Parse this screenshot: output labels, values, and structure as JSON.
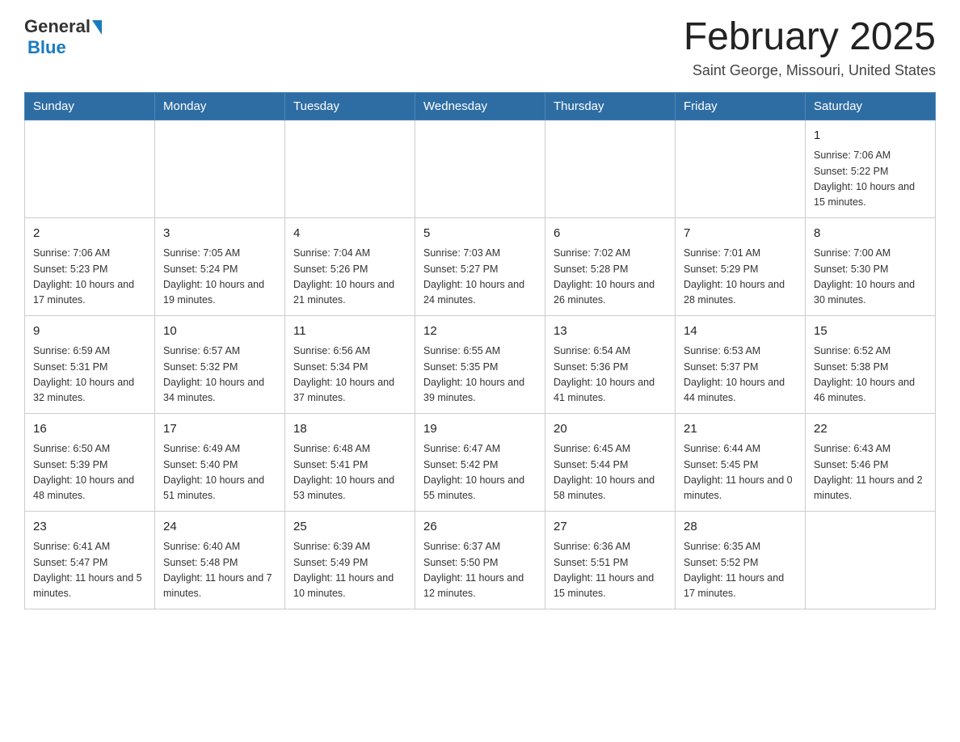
{
  "header": {
    "logo_general": "General",
    "logo_blue": "Blue",
    "month_title": "February 2025",
    "location": "Saint George, Missouri, United States"
  },
  "weekdays": [
    "Sunday",
    "Monday",
    "Tuesday",
    "Wednesday",
    "Thursday",
    "Friday",
    "Saturday"
  ],
  "weeks": [
    [
      {
        "day": "",
        "info": ""
      },
      {
        "day": "",
        "info": ""
      },
      {
        "day": "",
        "info": ""
      },
      {
        "day": "",
        "info": ""
      },
      {
        "day": "",
        "info": ""
      },
      {
        "day": "",
        "info": ""
      },
      {
        "day": "1",
        "info": "Sunrise: 7:06 AM\nSunset: 5:22 PM\nDaylight: 10 hours and 15 minutes."
      }
    ],
    [
      {
        "day": "2",
        "info": "Sunrise: 7:06 AM\nSunset: 5:23 PM\nDaylight: 10 hours and 17 minutes."
      },
      {
        "day": "3",
        "info": "Sunrise: 7:05 AM\nSunset: 5:24 PM\nDaylight: 10 hours and 19 minutes."
      },
      {
        "day": "4",
        "info": "Sunrise: 7:04 AM\nSunset: 5:26 PM\nDaylight: 10 hours and 21 minutes."
      },
      {
        "day": "5",
        "info": "Sunrise: 7:03 AM\nSunset: 5:27 PM\nDaylight: 10 hours and 24 minutes."
      },
      {
        "day": "6",
        "info": "Sunrise: 7:02 AM\nSunset: 5:28 PM\nDaylight: 10 hours and 26 minutes."
      },
      {
        "day": "7",
        "info": "Sunrise: 7:01 AM\nSunset: 5:29 PM\nDaylight: 10 hours and 28 minutes."
      },
      {
        "day": "8",
        "info": "Sunrise: 7:00 AM\nSunset: 5:30 PM\nDaylight: 10 hours and 30 minutes."
      }
    ],
    [
      {
        "day": "9",
        "info": "Sunrise: 6:59 AM\nSunset: 5:31 PM\nDaylight: 10 hours and 32 minutes."
      },
      {
        "day": "10",
        "info": "Sunrise: 6:57 AM\nSunset: 5:32 PM\nDaylight: 10 hours and 34 minutes."
      },
      {
        "day": "11",
        "info": "Sunrise: 6:56 AM\nSunset: 5:34 PM\nDaylight: 10 hours and 37 minutes."
      },
      {
        "day": "12",
        "info": "Sunrise: 6:55 AM\nSunset: 5:35 PM\nDaylight: 10 hours and 39 minutes."
      },
      {
        "day": "13",
        "info": "Sunrise: 6:54 AM\nSunset: 5:36 PM\nDaylight: 10 hours and 41 minutes."
      },
      {
        "day": "14",
        "info": "Sunrise: 6:53 AM\nSunset: 5:37 PM\nDaylight: 10 hours and 44 minutes."
      },
      {
        "day": "15",
        "info": "Sunrise: 6:52 AM\nSunset: 5:38 PM\nDaylight: 10 hours and 46 minutes."
      }
    ],
    [
      {
        "day": "16",
        "info": "Sunrise: 6:50 AM\nSunset: 5:39 PM\nDaylight: 10 hours and 48 minutes."
      },
      {
        "day": "17",
        "info": "Sunrise: 6:49 AM\nSunset: 5:40 PM\nDaylight: 10 hours and 51 minutes."
      },
      {
        "day": "18",
        "info": "Sunrise: 6:48 AM\nSunset: 5:41 PM\nDaylight: 10 hours and 53 minutes."
      },
      {
        "day": "19",
        "info": "Sunrise: 6:47 AM\nSunset: 5:42 PM\nDaylight: 10 hours and 55 minutes."
      },
      {
        "day": "20",
        "info": "Sunrise: 6:45 AM\nSunset: 5:44 PM\nDaylight: 10 hours and 58 minutes."
      },
      {
        "day": "21",
        "info": "Sunrise: 6:44 AM\nSunset: 5:45 PM\nDaylight: 11 hours and 0 minutes."
      },
      {
        "day": "22",
        "info": "Sunrise: 6:43 AM\nSunset: 5:46 PM\nDaylight: 11 hours and 2 minutes."
      }
    ],
    [
      {
        "day": "23",
        "info": "Sunrise: 6:41 AM\nSunset: 5:47 PM\nDaylight: 11 hours and 5 minutes."
      },
      {
        "day": "24",
        "info": "Sunrise: 6:40 AM\nSunset: 5:48 PM\nDaylight: 11 hours and 7 minutes."
      },
      {
        "day": "25",
        "info": "Sunrise: 6:39 AM\nSunset: 5:49 PM\nDaylight: 11 hours and 10 minutes."
      },
      {
        "day": "26",
        "info": "Sunrise: 6:37 AM\nSunset: 5:50 PM\nDaylight: 11 hours and 12 minutes."
      },
      {
        "day": "27",
        "info": "Sunrise: 6:36 AM\nSunset: 5:51 PM\nDaylight: 11 hours and 15 minutes."
      },
      {
        "day": "28",
        "info": "Sunrise: 6:35 AM\nSunset: 5:52 PM\nDaylight: 11 hours and 17 minutes."
      },
      {
        "day": "",
        "info": ""
      }
    ]
  ]
}
